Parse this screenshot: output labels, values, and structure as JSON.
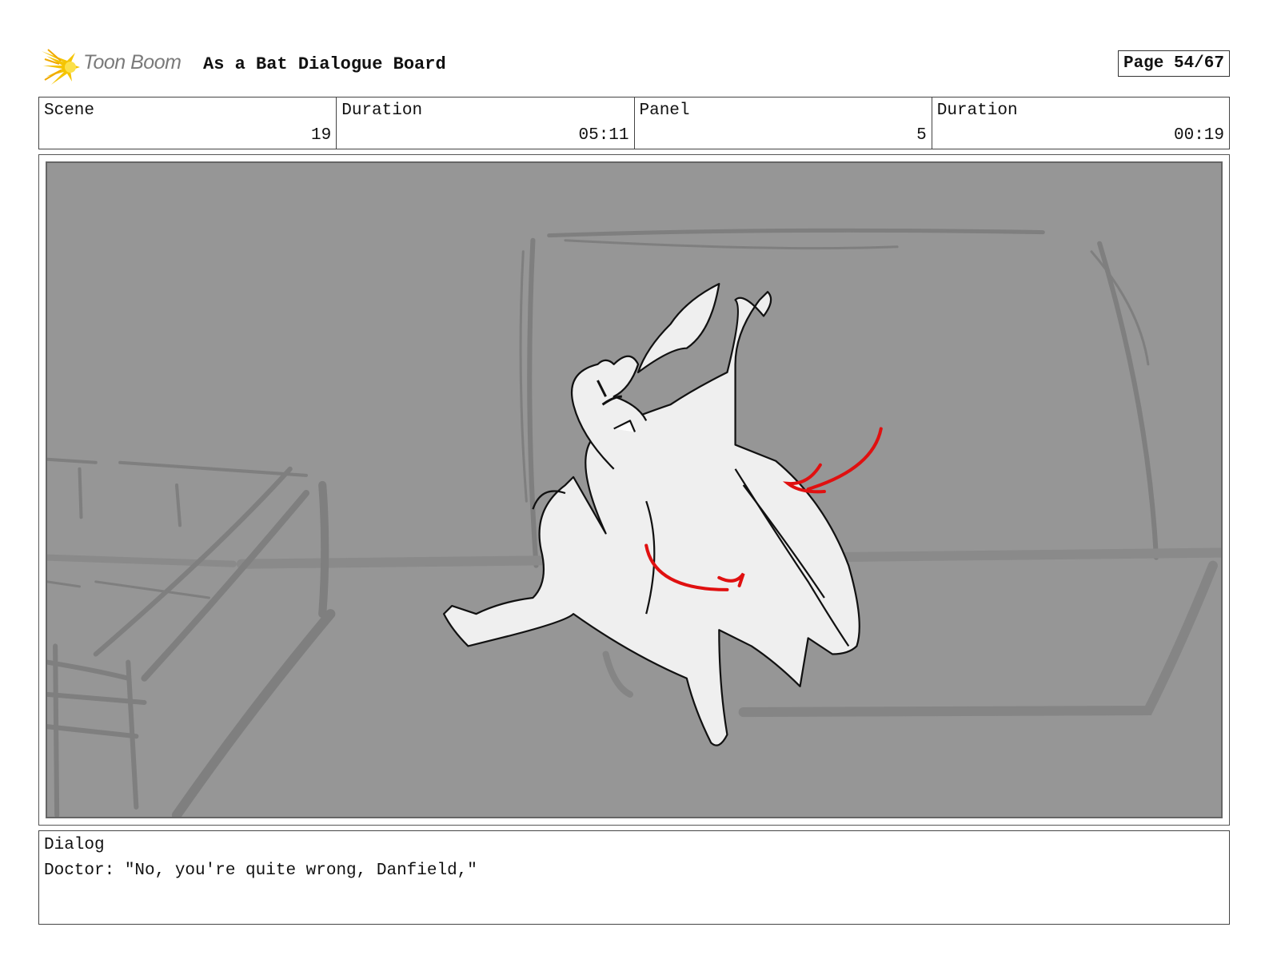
{
  "header": {
    "brand_name": "Toon Boom",
    "board_title": "As a Bat Dialogue Board",
    "page_label": "Page 54/67"
  },
  "info": {
    "scene_label": "Scene",
    "scene_value": "19",
    "scene_duration_label": "Duration",
    "scene_duration_value": "05:11",
    "panel_label": "Panel",
    "panel_value": "5",
    "panel_duration_label": "Duration",
    "panel_duration_value": "00:19"
  },
  "dialog": {
    "label": "Dialog",
    "text": "Doctor: \"No, you're quite wrong, Danfield,\""
  },
  "colors": {
    "panel_bg": "#969696",
    "sketch_bg_lines": "#7f7f7f",
    "character_fill": "#efefef",
    "ink": "#111111",
    "direction_arrows": "#e01010",
    "logo_yellow": "#f5c400"
  }
}
